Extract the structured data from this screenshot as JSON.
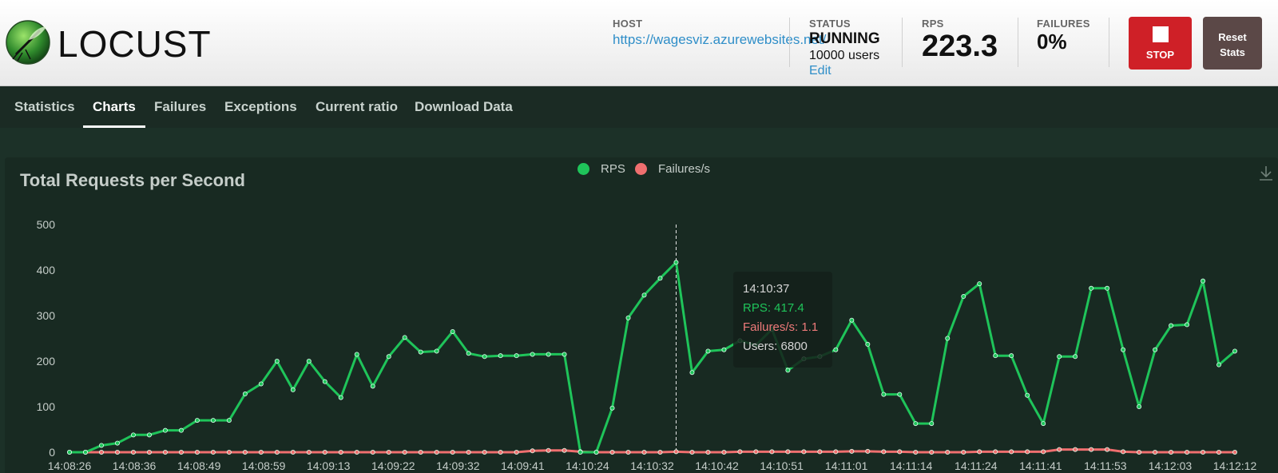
{
  "brand": {
    "name": "LOCUST"
  },
  "header": {
    "host_label": "HOST",
    "host_value": "https://wagesviz.azurewebsites.net/",
    "status_label": "STATUS",
    "status_value": "RUNNING",
    "users_value": "10000 users",
    "edit_label": "Edit",
    "rps_label": "RPS",
    "rps_value": "223.3",
    "failures_label": "FAILURES",
    "failures_value": "0%",
    "stop_label": "STOP",
    "reset_label": "Reset Stats"
  },
  "nav": {
    "tabs": [
      {
        "label": "Statistics",
        "active": false
      },
      {
        "label": "Charts",
        "active": true
      },
      {
        "label": "Failures",
        "active": false
      },
      {
        "label": "Exceptions",
        "active": false
      },
      {
        "label": "Current ratio",
        "active": false
      },
      {
        "label": "Download Data",
        "active": false
      }
    ]
  },
  "colors": {
    "rps": "#1fc45a",
    "failures": "#ef6f6f",
    "stop": "#cf2027",
    "reset": "#5b4847"
  },
  "tooltip": {
    "time": "14:10:37",
    "rps": "RPS: 417.4",
    "failures": "Failures/s: 1.1",
    "users": "Users: 6800"
  },
  "chart_data": {
    "type": "line",
    "title": "Total Requests per Second",
    "legend": [
      "RPS",
      "Failures/s"
    ],
    "ylim": [
      0,
      500
    ],
    "yticks": [
      0,
      100,
      200,
      300,
      400,
      500
    ],
    "xtick_labels": [
      "14:08:26",
      "14:08:36",
      "14:08:49",
      "14:08:59",
      "14:09:13",
      "14:09:22",
      "14:09:32",
      "14:09:41",
      "14:10:24",
      "14:10:32",
      "14:10:42",
      "14:10:51",
      "14:11:01",
      "14:11:14",
      "14:11:24",
      "14:11:41",
      "14:11:53",
      "14:12:03",
      "14:12:12"
    ],
    "series": [
      {
        "name": "RPS",
        "values": [
          0,
          0,
          15,
          20,
          38,
          38,
          48,
          48,
          70,
          70,
          70,
          128,
          150,
          200,
          137,
          200,
          155,
          120,
          215,
          145,
          210,
          252,
          220,
          222,
          265,
          217,
          210,
          212,
          212,
          215,
          215,
          215,
          0,
          0,
          97,
          295,
          345,
          382,
          417,
          175,
          222,
          225,
          245,
          235,
          270,
          180,
          205,
          210,
          225,
          290,
          237,
          127,
          127,
          63,
          63,
          250,
          342,
          370,
          212,
          212,
          125,
          63,
          210,
          210,
          360,
          360,
          225,
          100,
          225,
          278,
          280,
          376,
          192,
          222
        ]
      },
      {
        "name": "Failures/s",
        "values": [
          0,
          0,
          0,
          0,
          0,
          0,
          0,
          0,
          0,
          0,
          0,
          0,
          0,
          0,
          0,
          0,
          0,
          0,
          0,
          0,
          0,
          0,
          0,
          0,
          0,
          0,
          0,
          0,
          0,
          3,
          4,
          4,
          1,
          0,
          0,
          0,
          0,
          0,
          1.1,
          0,
          0,
          0,
          1,
          1,
          1,
          1,
          1,
          1,
          1,
          2,
          2,
          1,
          1,
          0,
          0,
          0,
          0,
          1,
          1,
          1,
          1,
          1,
          6,
          6,
          6,
          6,
          1,
          0,
          0,
          0,
          0,
          0,
          0,
          0
        ]
      }
    ]
  }
}
